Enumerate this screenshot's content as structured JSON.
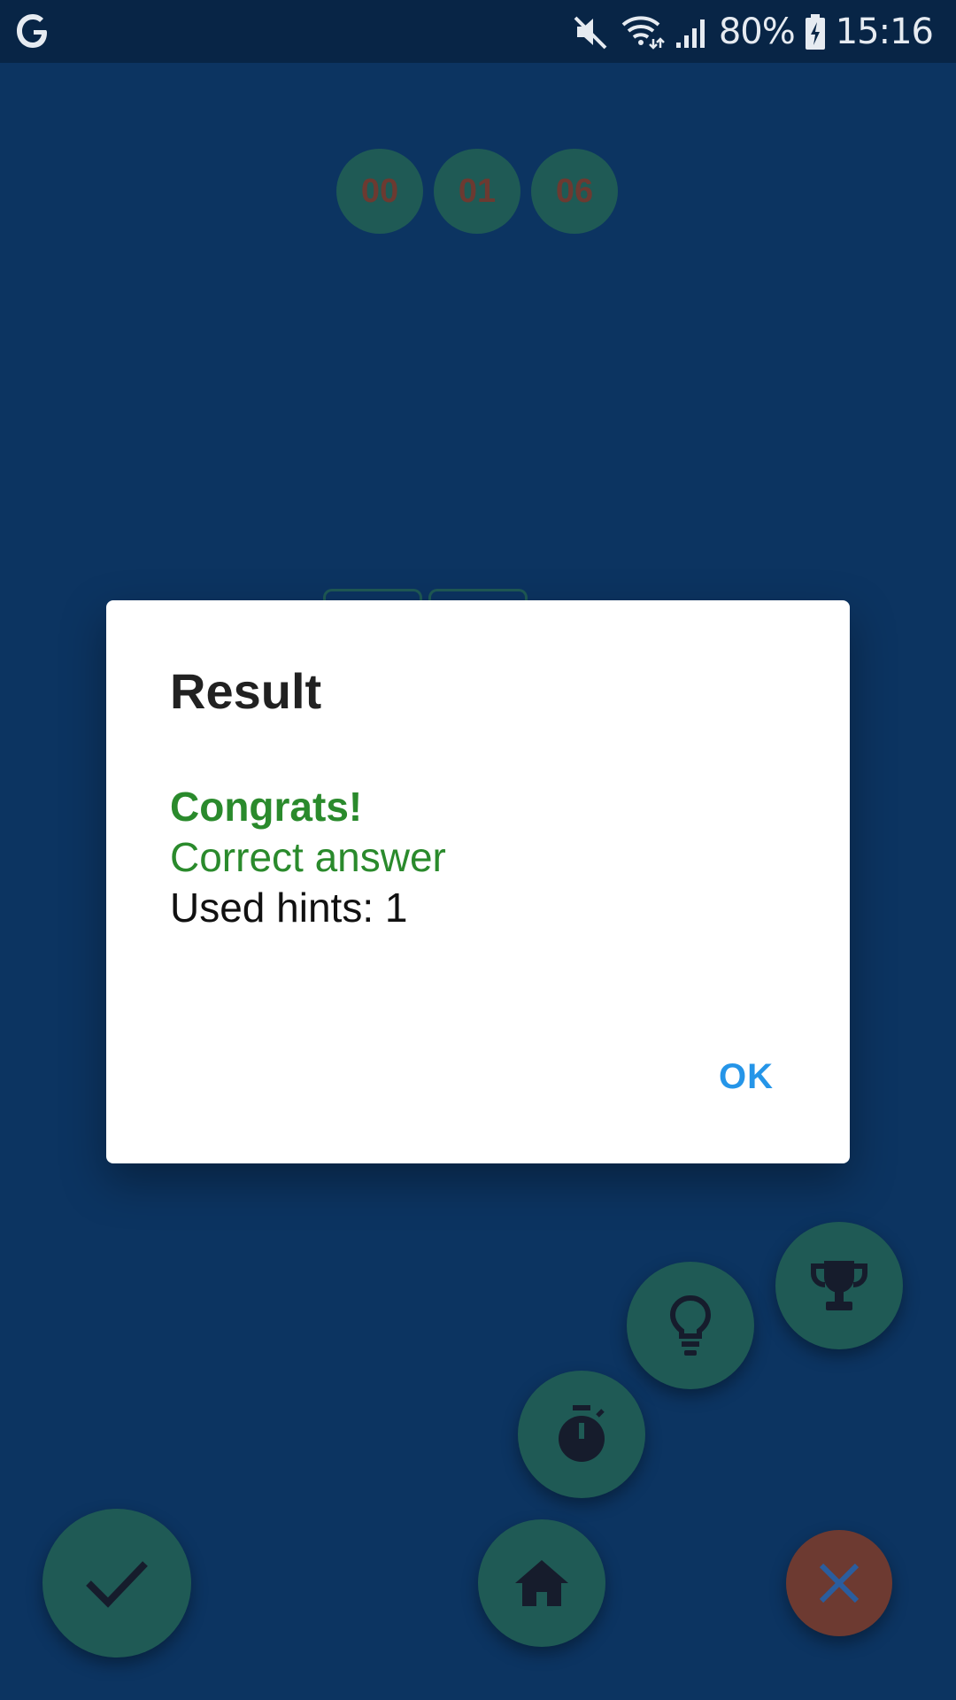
{
  "status_bar": {
    "battery": "80%",
    "time": "15:16",
    "icons": [
      "google-icon",
      "mute-icon",
      "wifi-icon",
      "signal-icon",
      "battery-icon"
    ]
  },
  "timer": {
    "hours": "00",
    "minutes": "01",
    "seconds": "06"
  },
  "dialog": {
    "title": "Result",
    "line1": "Congrats!",
    "line2": "Correct answer",
    "line3": "Used hints: 1",
    "ok_label": "OK"
  },
  "fabs": [
    "trophy-icon",
    "hint-bulb-icon",
    "timer-icon",
    "check-icon",
    "home-icon",
    "close-icon"
  ],
  "colors": {
    "background": "#0c3461",
    "status_bar": "#082546",
    "fab": "#1f5a55",
    "close_fab": "#6d3a31",
    "success_text": "#2a8a2c",
    "ok_button": "#2595e8"
  }
}
